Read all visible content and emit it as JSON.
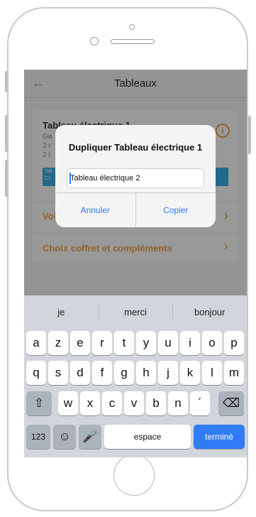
{
  "nav": {
    "title": "Tableaux",
    "back_icon": "back-arrow-icon"
  },
  "card": {
    "title": "Tableau électrique 1",
    "line1": "Ga",
    "line2": "2 r",
    "line3": "2 l",
    "stripe1": "Tab",
    "stripe2": "C1",
    "row1_label": "Voir le tableau",
    "row2_label": "Choix coffret et compléments"
  },
  "alert": {
    "title": "Dupliquer Tableau électrique 1",
    "field_value": "Tableau électrique 2",
    "cancel_label": "Annuler",
    "confirm_label": "Copier"
  },
  "keyboard": {
    "suggestions": [
      "je",
      "merci",
      "bonjour"
    ],
    "row1": [
      "a",
      "z",
      "e",
      "r",
      "t",
      "y",
      "u",
      "i",
      "o",
      "p"
    ],
    "row2": [
      "q",
      "s",
      "d",
      "f",
      "g",
      "h",
      "j",
      "k",
      "l",
      "m"
    ],
    "row3": [
      "w",
      "x",
      "c",
      "v",
      "b",
      "n",
      "´"
    ],
    "numbers_key": "123",
    "space_key": "espace",
    "done_key": "terminé"
  },
  "colors": {
    "accent": "#f0a24a",
    "ios_blue": "#2f7cf6",
    "stripe": "#3ab0e4"
  }
}
